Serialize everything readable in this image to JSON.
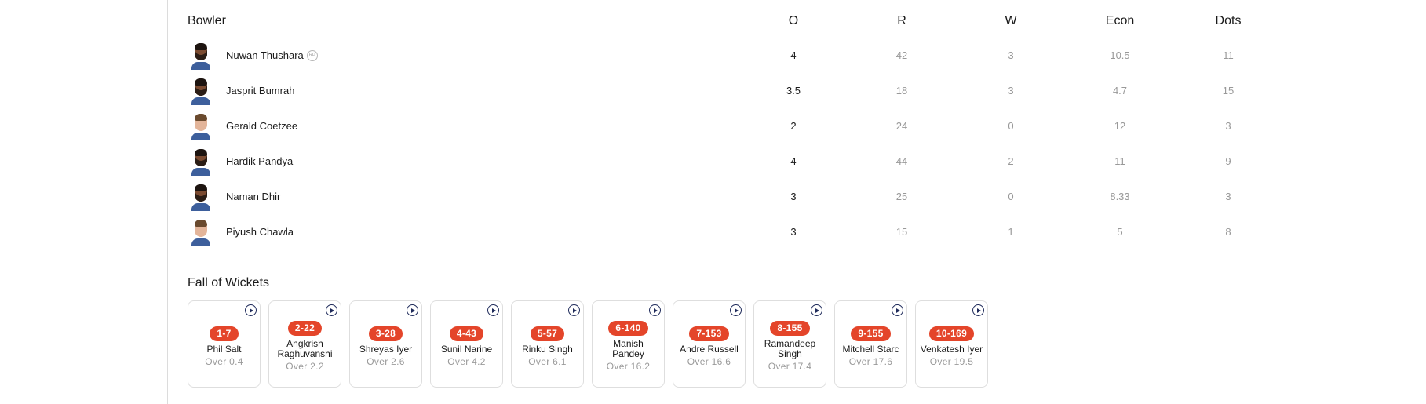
{
  "bowling": {
    "headers": {
      "bowler": "Bowler",
      "overs": "O",
      "runs": "R",
      "wickets": "W",
      "economy": "Econ",
      "dots": "Dots"
    },
    "rows": [
      {
        "name": "Nuwan Thushara",
        "badge": "RP",
        "overs": "4",
        "runs": "42",
        "wickets": "3",
        "economy": "10.5",
        "dots": "11"
      },
      {
        "name": "Jasprit Bumrah",
        "badge": null,
        "overs": "3.5",
        "runs": "18",
        "wickets": "3",
        "economy": "4.7",
        "dots": "15"
      },
      {
        "name": "Gerald Coetzee",
        "badge": null,
        "overs": "2",
        "runs": "24",
        "wickets": "0",
        "economy": "12",
        "dots": "3"
      },
      {
        "name": "Hardik Pandya",
        "badge": null,
        "overs": "4",
        "runs": "44",
        "wickets": "2",
        "economy": "11",
        "dots": "9"
      },
      {
        "name": "Naman Dhir",
        "badge": null,
        "overs": "3",
        "runs": "25",
        "wickets": "0",
        "economy": "8.33",
        "dots": "3"
      },
      {
        "name": "Piyush Chawla",
        "badge": null,
        "overs": "3",
        "runs": "15",
        "wickets": "1",
        "economy": "5",
        "dots": "8"
      }
    ]
  },
  "fall_of_wickets": {
    "title": "Fall of Wickets",
    "play_icon": "play-circle-icon",
    "cards": [
      {
        "score": "1-7",
        "name": "Phil Salt",
        "over": "Over 0.4"
      },
      {
        "score": "2-22",
        "name": "Angkrish Raghuvanshi",
        "over": "Over 2.2"
      },
      {
        "score": "3-28",
        "name": "Shreyas Iyer",
        "over": "Over 2.6"
      },
      {
        "score": "4-43",
        "name": "Sunil Narine",
        "over": "Over 4.2"
      },
      {
        "score": "5-57",
        "name": "Rinku Singh",
        "over": "Over 6.1"
      },
      {
        "score": "6-140",
        "name": "Manish Pandey",
        "over": "Over 16.2"
      },
      {
        "score": "7-153",
        "name": "Andre Russell",
        "over": "Over 16.6"
      },
      {
        "score": "8-155",
        "name": "Ramandeep Singh",
        "over": "Over 17.4"
      },
      {
        "score": "9-155",
        "name": "Mitchell Starc",
        "over": "Over 17.6"
      },
      {
        "score": "10-169",
        "name": "Venkatesh Iyer",
        "over": "Over 19.5"
      }
    ]
  },
  "colors": {
    "badge_red": "#e4452a",
    "play_icon_navy": "#1e2a5a",
    "muted_text": "#999999"
  }
}
